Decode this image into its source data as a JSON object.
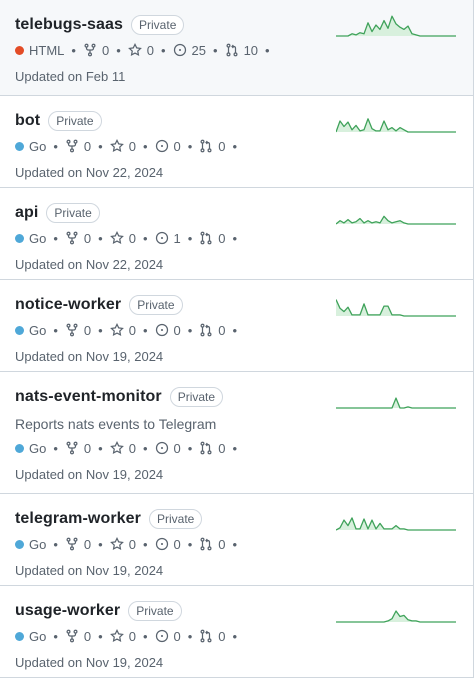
{
  "repos": [
    {
      "name": "telebugs-saas",
      "visibility": "Private",
      "description": "",
      "language": "HTML",
      "lang_color": "#e34c26",
      "forks": "0",
      "stars": "0",
      "issues": "25",
      "prs": "10",
      "updated": "Updated on Feb 11",
      "activity": [
        0,
        0,
        0,
        0,
        0.1,
        0.05,
        0.15,
        0.1,
        0.6,
        0.2,
        0.5,
        0.3,
        0.7,
        0.35,
        0.9,
        0.55,
        0.4,
        0.3,
        0.45,
        0.1,
        0.05,
        0,
        0,
        0,
        0,
        0,
        0,
        0,
        0,
        0,
        0
      ],
      "highlight": true
    },
    {
      "name": "bot",
      "visibility": "Private",
      "description": "",
      "language": "Go",
      "lang_color": "#4fa8d8",
      "forks": "0",
      "stars": "0",
      "issues": "0",
      "prs": "0",
      "updated": "Updated on Nov 22, 2024",
      "activity": [
        0,
        0.5,
        0.25,
        0.45,
        0.1,
        0.3,
        0.05,
        0.1,
        0.6,
        0.15,
        0.05,
        0.05,
        0.5,
        0.1,
        0.2,
        0.05,
        0.2,
        0.1,
        0,
        0,
        0,
        0,
        0,
        0,
        0,
        0,
        0,
        0,
        0,
        0,
        0
      ],
      "highlight": false
    },
    {
      "name": "api",
      "visibility": "Private",
      "description": "",
      "language": "Go",
      "lang_color": "#4fa8d8",
      "forks": "0",
      "stars": "0",
      "issues": "1",
      "prs": "0",
      "updated": "Updated on Nov 22, 2024",
      "activity": [
        0,
        0.15,
        0.05,
        0.2,
        0.05,
        0.1,
        0.25,
        0.05,
        0.15,
        0.05,
        0.1,
        0.05,
        0.35,
        0.15,
        0.05,
        0.1,
        0.15,
        0.05,
        0,
        0,
        0,
        0,
        0,
        0,
        0,
        0,
        0,
        0,
        0,
        0,
        0
      ],
      "highlight": false
    },
    {
      "name": "notice-worker",
      "visibility": "Private",
      "description": "",
      "language": "Go",
      "lang_color": "#4fa8d8",
      "forks": "0",
      "stars": "0",
      "issues": "0",
      "prs": "0",
      "updated": "Updated on Nov 19, 2024",
      "activity": [
        0.75,
        0.35,
        0.2,
        0.4,
        0.05,
        0.05,
        0.05,
        0.55,
        0.05,
        0.05,
        0.05,
        0.05,
        0.45,
        0.45,
        0.05,
        0.05,
        0.05,
        0,
        0,
        0,
        0,
        0,
        0,
        0,
        0,
        0,
        0,
        0,
        0,
        0,
        0
      ],
      "highlight": false
    },
    {
      "name": "nats-event-monitor",
      "visibility": "Private",
      "description": "Reports nats events to Telegram",
      "language": "Go",
      "lang_color": "#4fa8d8",
      "forks": "0",
      "stars": "0",
      "issues": "0",
      "prs": "0",
      "updated": "Updated on Nov 19, 2024",
      "activity": [
        0,
        0,
        0,
        0,
        0,
        0,
        0,
        0,
        0,
        0,
        0,
        0,
        0,
        0,
        0,
        0.45,
        0,
        0,
        0.05,
        0,
        0,
        0,
        0,
        0,
        0,
        0,
        0,
        0,
        0,
        0,
        0
      ],
      "highlight": false
    },
    {
      "name": "telegram-worker",
      "visibility": "Private",
      "description": "",
      "language": "Go",
      "lang_color": "#4fa8d8",
      "forks": "0",
      "stars": "0",
      "issues": "0",
      "prs": "0",
      "updated": "Updated on Nov 19, 2024",
      "activity": [
        0,
        0.1,
        0.45,
        0.2,
        0.55,
        0.05,
        0.05,
        0.5,
        0.05,
        0.45,
        0.05,
        0.3,
        0.05,
        0.05,
        0.05,
        0.2,
        0.05,
        0.05,
        0,
        0,
        0,
        0,
        0,
        0,
        0,
        0,
        0,
        0,
        0,
        0,
        0
      ],
      "highlight": false
    },
    {
      "name": "usage-worker",
      "visibility": "Private",
      "description": "",
      "language": "Go",
      "lang_color": "#4fa8d8",
      "forks": "0",
      "stars": "0",
      "issues": "0",
      "prs": "0",
      "updated": "Updated on Nov 19, 2024",
      "activity": [
        0,
        0,
        0,
        0,
        0,
        0,
        0,
        0,
        0,
        0,
        0,
        0,
        0,
        0.05,
        0.15,
        0.5,
        0.25,
        0.3,
        0.1,
        0.05,
        0.05,
        0,
        0,
        0,
        0,
        0,
        0,
        0,
        0,
        0,
        0
      ],
      "highlight": false
    }
  ]
}
